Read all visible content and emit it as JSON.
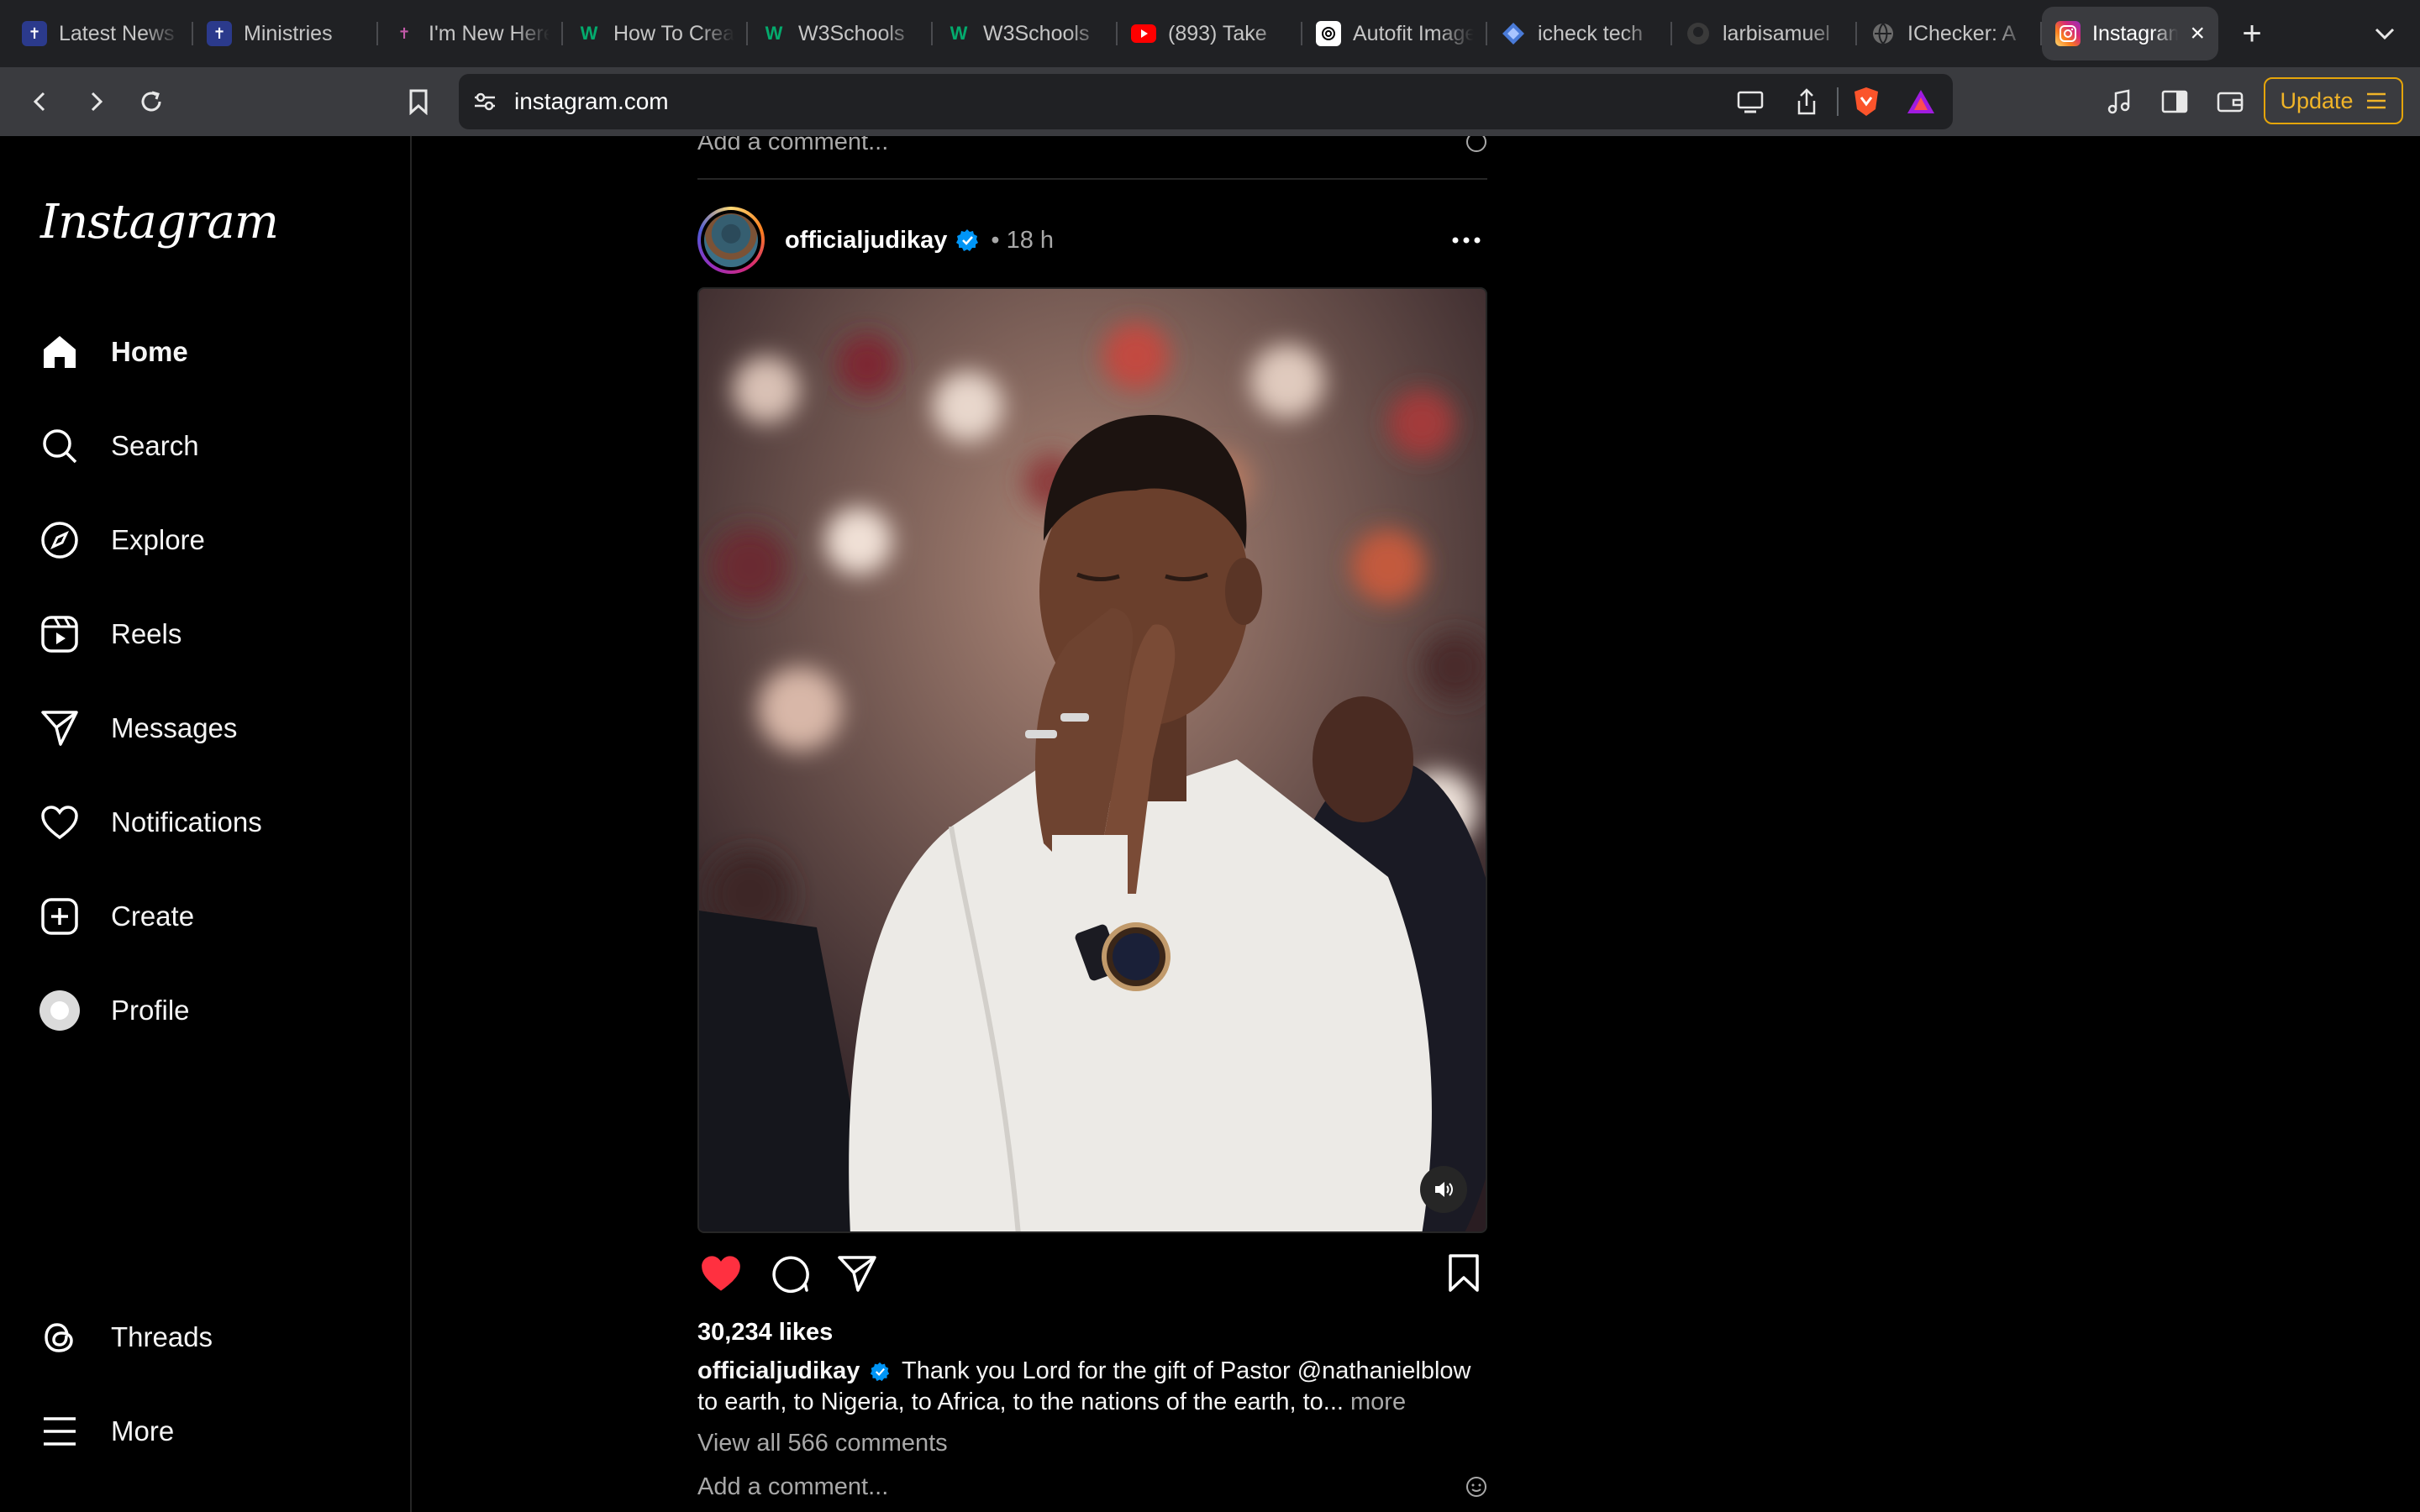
{
  "browser": {
    "tabs": [
      {
        "label": "Latest News",
        "icon": "ministry-crest-icon",
        "color": "#2b3a8c"
      },
      {
        "label": "Ministries",
        "icon": "ministry-crest-icon",
        "color": "#2b3a8c"
      },
      {
        "label": "I'm New Here",
        "icon": "cross-icon",
        "color": "#7a2d6e"
      },
      {
        "label": "How To Create",
        "icon": "w3schools-icon",
        "color": "#04aa6d"
      },
      {
        "label": "W3Schools",
        "icon": "w3schools-icon",
        "color": "#04aa6d"
      },
      {
        "label": "W3Schools",
        "icon": "w3schools-icon",
        "color": "#04aa6d"
      },
      {
        "label": "(893) Take",
        "icon": "youtube-icon",
        "color": "#ff0000"
      },
      {
        "label": "Autofit Image",
        "icon": "openai-icon",
        "color": "#ffffff"
      },
      {
        "label": "icheck tech",
        "icon": "gemini-icon",
        "color": "#4a7bd8"
      },
      {
        "label": "larbisamuel",
        "icon": "github-icon",
        "color": "#3a3a3a"
      },
      {
        "label": "IChecker: A",
        "icon": "globe-icon",
        "color": "#5a5a5a"
      },
      {
        "label": "Instagram",
        "icon": "instagram-icon",
        "color": "#d62976",
        "active": true
      }
    ],
    "url": "instagram.com",
    "update_label": "Update"
  },
  "sidebar": {
    "logo": "Instagram",
    "items": [
      {
        "label": "Home",
        "icon": "home-icon"
      },
      {
        "label": "Search",
        "icon": "search-icon"
      },
      {
        "label": "Explore",
        "icon": "compass-icon"
      },
      {
        "label": "Reels",
        "icon": "reels-icon"
      },
      {
        "label": "Messages",
        "icon": "paper-plane-icon"
      },
      {
        "label": "Notifications",
        "icon": "heart-icon"
      },
      {
        "label": "Create",
        "icon": "plus-square-icon"
      },
      {
        "label": "Profile",
        "icon": "profile-avatar-icon"
      },
      {
        "label": "Threads",
        "icon": "threads-icon"
      },
      {
        "label": "More",
        "icon": "hamburger-icon"
      }
    ]
  },
  "feed": {
    "previous_post": {
      "add_comment_placeholder": "Add a comment..."
    },
    "post": {
      "username": "officialjudikay",
      "time": "• 18 h",
      "likes": "30,234 likes",
      "caption_user": "officialjudikay",
      "caption_text": "Thank you Lord for the gift of Pastor @nathanielblow to earth, to Nigeria, to Africa, to the nations of the earth, to...",
      "caption_more": "more",
      "view_comments": "View all 566 comments",
      "add_comment_placeholder": "Add a comment...",
      "liked": true,
      "accent_like_color": "#ff3040",
      "verified_color": "#0095f6"
    }
  }
}
